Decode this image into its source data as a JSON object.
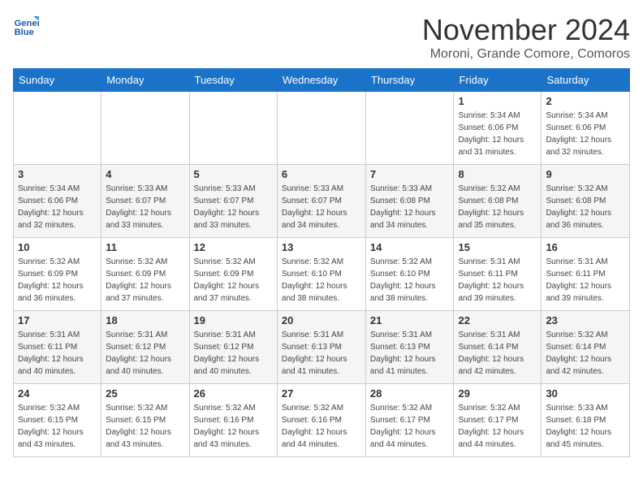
{
  "header": {
    "logo_line1": "General",
    "logo_line2": "Blue",
    "month_title": "November 2024",
    "subtitle": "Moroni, Grande Comore, Comoros"
  },
  "days_of_week": [
    "Sunday",
    "Monday",
    "Tuesday",
    "Wednesday",
    "Thursday",
    "Friday",
    "Saturday"
  ],
  "weeks": [
    [
      {
        "day": "",
        "info": ""
      },
      {
        "day": "",
        "info": ""
      },
      {
        "day": "",
        "info": ""
      },
      {
        "day": "",
        "info": ""
      },
      {
        "day": "",
        "info": ""
      },
      {
        "day": "1",
        "info": "Sunrise: 5:34 AM\nSunset: 6:06 PM\nDaylight: 12 hours\nand 31 minutes."
      },
      {
        "day": "2",
        "info": "Sunrise: 5:34 AM\nSunset: 6:06 PM\nDaylight: 12 hours\nand 32 minutes."
      }
    ],
    [
      {
        "day": "3",
        "info": "Sunrise: 5:34 AM\nSunset: 6:06 PM\nDaylight: 12 hours\nand 32 minutes."
      },
      {
        "day": "4",
        "info": "Sunrise: 5:33 AM\nSunset: 6:07 PM\nDaylight: 12 hours\nand 33 minutes."
      },
      {
        "day": "5",
        "info": "Sunrise: 5:33 AM\nSunset: 6:07 PM\nDaylight: 12 hours\nand 33 minutes."
      },
      {
        "day": "6",
        "info": "Sunrise: 5:33 AM\nSunset: 6:07 PM\nDaylight: 12 hours\nand 34 minutes."
      },
      {
        "day": "7",
        "info": "Sunrise: 5:33 AM\nSunset: 6:08 PM\nDaylight: 12 hours\nand 34 minutes."
      },
      {
        "day": "8",
        "info": "Sunrise: 5:32 AM\nSunset: 6:08 PM\nDaylight: 12 hours\nand 35 minutes."
      },
      {
        "day": "9",
        "info": "Sunrise: 5:32 AM\nSunset: 6:08 PM\nDaylight: 12 hours\nand 36 minutes."
      }
    ],
    [
      {
        "day": "10",
        "info": "Sunrise: 5:32 AM\nSunset: 6:09 PM\nDaylight: 12 hours\nand 36 minutes."
      },
      {
        "day": "11",
        "info": "Sunrise: 5:32 AM\nSunset: 6:09 PM\nDaylight: 12 hours\nand 37 minutes."
      },
      {
        "day": "12",
        "info": "Sunrise: 5:32 AM\nSunset: 6:09 PM\nDaylight: 12 hours\nand 37 minutes."
      },
      {
        "day": "13",
        "info": "Sunrise: 5:32 AM\nSunset: 6:10 PM\nDaylight: 12 hours\nand 38 minutes."
      },
      {
        "day": "14",
        "info": "Sunrise: 5:32 AM\nSunset: 6:10 PM\nDaylight: 12 hours\nand 38 minutes."
      },
      {
        "day": "15",
        "info": "Sunrise: 5:31 AM\nSunset: 6:11 PM\nDaylight: 12 hours\nand 39 minutes."
      },
      {
        "day": "16",
        "info": "Sunrise: 5:31 AM\nSunset: 6:11 PM\nDaylight: 12 hours\nand 39 minutes."
      }
    ],
    [
      {
        "day": "17",
        "info": "Sunrise: 5:31 AM\nSunset: 6:11 PM\nDaylight: 12 hours\nand 40 minutes."
      },
      {
        "day": "18",
        "info": "Sunrise: 5:31 AM\nSunset: 6:12 PM\nDaylight: 12 hours\nand 40 minutes."
      },
      {
        "day": "19",
        "info": "Sunrise: 5:31 AM\nSunset: 6:12 PM\nDaylight: 12 hours\nand 40 minutes."
      },
      {
        "day": "20",
        "info": "Sunrise: 5:31 AM\nSunset: 6:13 PM\nDaylight: 12 hours\nand 41 minutes."
      },
      {
        "day": "21",
        "info": "Sunrise: 5:31 AM\nSunset: 6:13 PM\nDaylight: 12 hours\nand 41 minutes."
      },
      {
        "day": "22",
        "info": "Sunrise: 5:31 AM\nSunset: 6:14 PM\nDaylight: 12 hours\nand 42 minutes."
      },
      {
        "day": "23",
        "info": "Sunrise: 5:32 AM\nSunset: 6:14 PM\nDaylight: 12 hours\nand 42 minutes."
      }
    ],
    [
      {
        "day": "24",
        "info": "Sunrise: 5:32 AM\nSunset: 6:15 PM\nDaylight: 12 hours\nand 43 minutes."
      },
      {
        "day": "25",
        "info": "Sunrise: 5:32 AM\nSunset: 6:15 PM\nDaylight: 12 hours\nand 43 minutes."
      },
      {
        "day": "26",
        "info": "Sunrise: 5:32 AM\nSunset: 6:16 PM\nDaylight: 12 hours\nand 43 minutes."
      },
      {
        "day": "27",
        "info": "Sunrise: 5:32 AM\nSunset: 6:16 PM\nDaylight: 12 hours\nand 44 minutes."
      },
      {
        "day": "28",
        "info": "Sunrise: 5:32 AM\nSunset: 6:17 PM\nDaylight: 12 hours\nand 44 minutes."
      },
      {
        "day": "29",
        "info": "Sunrise: 5:32 AM\nSunset: 6:17 PM\nDaylight: 12 hours\nand 44 minutes."
      },
      {
        "day": "30",
        "info": "Sunrise: 5:33 AM\nSunset: 6:18 PM\nDaylight: 12 hours\nand 45 minutes."
      }
    ]
  ]
}
